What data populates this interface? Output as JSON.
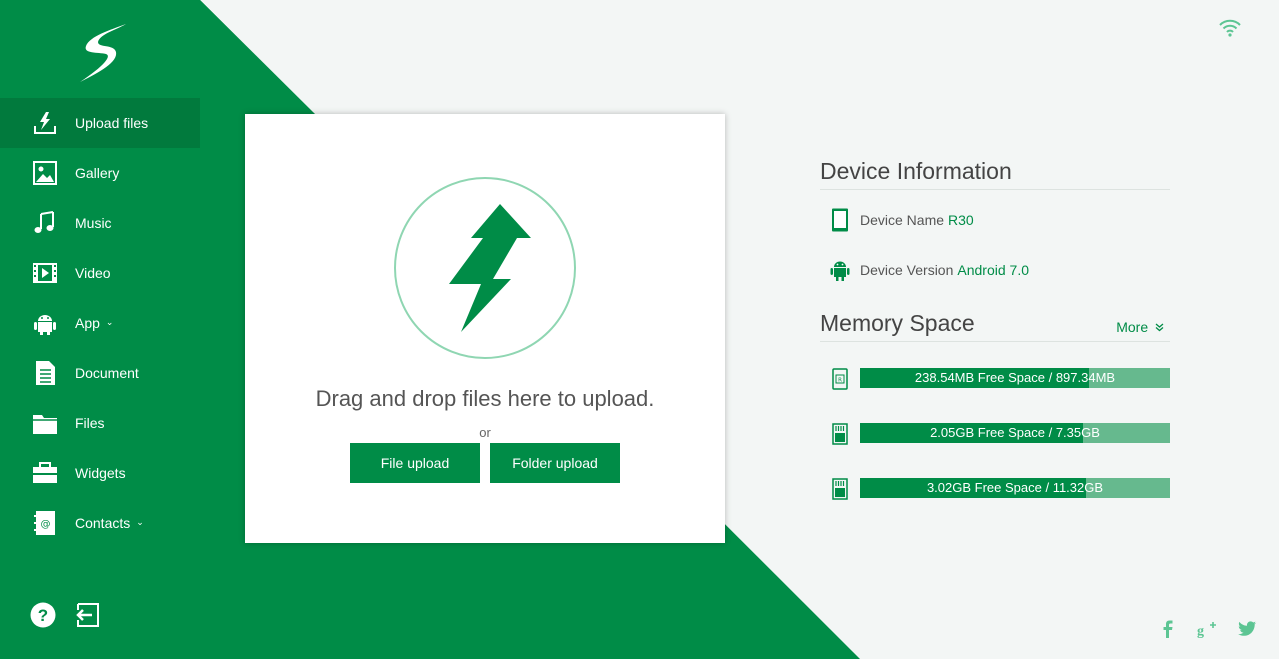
{
  "colors": {
    "brand": "#008c47",
    "brand_dark": "#017a3d",
    "brand_light": "#66b98e"
  },
  "sidebar": {
    "items": [
      {
        "label": "Upload files",
        "icon": "upload-icon",
        "active": true
      },
      {
        "label": "Gallery",
        "icon": "gallery-icon"
      },
      {
        "label": "Music",
        "icon": "music-icon"
      },
      {
        "label": "Video",
        "icon": "video-icon"
      },
      {
        "label": "App",
        "icon": "android-icon",
        "caret": "⌄"
      },
      {
        "label": "Document",
        "icon": "document-icon"
      },
      {
        "label": "Files",
        "icon": "folder-icon"
      },
      {
        "label": "Widgets",
        "icon": "toolbox-icon"
      },
      {
        "label": "Contacts",
        "icon": "contacts-icon",
        "caret": "⌄"
      }
    ],
    "help_icon": "help-icon",
    "logout_icon": "logout-icon"
  },
  "upload": {
    "drop_text": "Drag and drop files here to upload.",
    "or_text": "or",
    "file_button": "File upload",
    "folder_button": "Folder upload"
  },
  "device": {
    "title": "Device Information",
    "name_label": "Device Name",
    "name_value": "R30",
    "version_label": "Device Version",
    "version_value": "Android 7.0"
  },
  "memory": {
    "title": "Memory Space",
    "more_label": "More",
    "more_icon": "double-chevron-down-icon",
    "items": [
      {
        "text": "238.54MB Free Space / 897.34MB",
        "used_fraction": 0.74,
        "icon": "phone-storage-icon"
      },
      {
        "text": "2.05GB Free Space / 7.35GB",
        "used_fraction": 0.72,
        "icon": "sd-card-icon"
      },
      {
        "text": "3.02GB Free Space / 11.32GB",
        "used_fraction": 0.73,
        "icon": "sd-card-icon"
      }
    ]
  },
  "status": {
    "wifi_icon": "wifi-icon"
  },
  "social": [
    "facebook-icon",
    "google-plus-icon",
    "twitter-icon"
  ]
}
